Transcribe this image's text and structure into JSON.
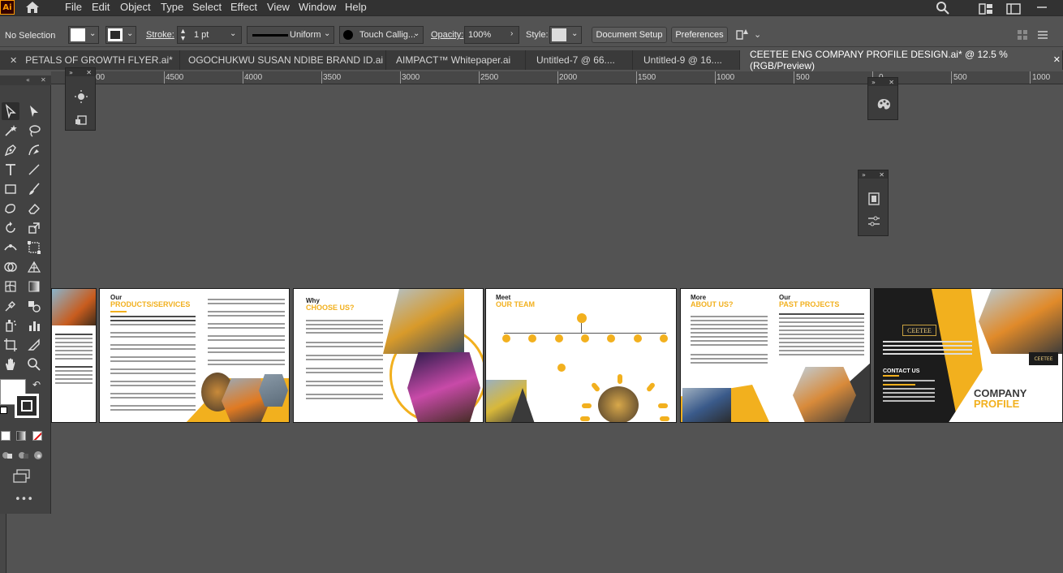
{
  "app": {
    "logo_text": "Ai",
    "menu": [
      "File",
      "Edit",
      "Object",
      "Type",
      "Select",
      "Effect",
      "View",
      "Window",
      "Help"
    ]
  },
  "control_bar": {
    "selection_status": "No Selection",
    "stroke_label": "Stroke:",
    "stroke_value": "1 pt",
    "stroke_profile": "Uniform",
    "brush_name": "Touch Callig...",
    "opacity_label": "Opacity:",
    "opacity_value": "100%",
    "style_label": "Style:",
    "document_setup_label": "Document Setup",
    "preferences_label": "Preferences"
  },
  "tabs": [
    {
      "label": "PETALS OF GROWTH FLYER.ai*",
      "active": false
    },
    {
      "label": "OGOCHUKWU SUSAN NDIBE BRAND ID.ai",
      "active": false
    },
    {
      "label": "AIMPACT™ Whitepaper.ai",
      "active": false
    },
    {
      "label": "Untitled-7 @ 66....",
      "active": false
    },
    {
      "label": "Untitled-9 @ 16....",
      "active": false
    },
    {
      "label": "CEETEE ENG COMPANY PROFILE DESIGN.ai* @ 12.5 % (RGB/Preview)",
      "active": true
    }
  ],
  "ruler": {
    "labels": [
      "00",
      "4500",
      "4000",
      "3500",
      "3000",
      "2500",
      "2000",
      "1500",
      "1000",
      "500",
      "0",
      "500",
      "1000"
    ]
  },
  "artboards": {
    "products": {
      "t1": "Our",
      "t2": "PRODUCTS/SERVICES"
    },
    "why": {
      "t1": "Why",
      "t2": "CHOOSE US?"
    },
    "team": {
      "t1": "Meet",
      "t2": "OUR TEAM"
    },
    "about": {
      "t1": "More",
      "t2": "ABOUT US?"
    },
    "projects": {
      "t1": "Our",
      "t2": "PAST PROJECTS"
    },
    "cover": {
      "brand": "CEETEE",
      "contact": "CONTACT US",
      "title_1": "COMPANY",
      "title_2": "PROFILE"
    }
  },
  "colors": {
    "accent_yellow": "#f2b01e",
    "dark_cover": "#1c1c1c",
    "ui_bg": "#535353",
    "ui_panel": "#424242"
  },
  "icons": {
    "toolbar": [
      "selection-tool",
      "direct-selection-tool",
      "magic-wand-tool",
      "lasso-tool",
      "pen-tool",
      "curvature-tool",
      "type-tool",
      "line-segment-tool",
      "rectangle-tool",
      "paintbrush-tool",
      "shaper-tool",
      "eraser-tool",
      "rotate-tool",
      "scale-tool",
      "width-tool",
      "free-transform-tool",
      "shape-builder-tool",
      "perspective-grid-tool",
      "mesh-tool",
      "gradient-tool",
      "eyedropper-tool",
      "blend-tool",
      "symbol-sprayer-tool",
      "column-graph-tool",
      "artboard-tool",
      "slice-tool",
      "hand-tool",
      "zoom-tool"
    ]
  }
}
